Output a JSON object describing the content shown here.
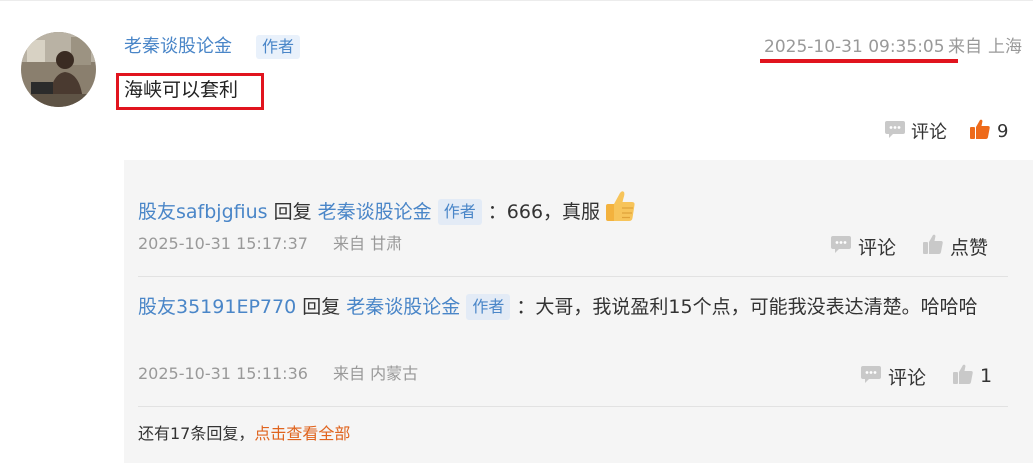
{
  "post": {
    "author": "老秦谈股论金",
    "badge": "作者",
    "time": "2025-10-31 09:35:05",
    "from_label": "来自",
    "location": "上海",
    "body": "海峡可以套利",
    "comment_label": "评论",
    "like_count": "9"
  },
  "replies": [
    {
      "user": "股友safbjgfius",
      "reply_word": "回复",
      "target": "老秦谈股论金",
      "badge": "作者",
      "text": "：666，真服",
      "time": "2025-10-31 15:17:37",
      "from_label": "来自",
      "location": "甘肃",
      "comment_label": "评论",
      "like_label": "点赞"
    },
    {
      "user": "股友35191EP770",
      "reply_word": "回复",
      "target": "老秦谈股论金",
      "badge": "作者",
      "text": "：大哥，我说盈利15个点，可能我没表达清楚。哈哈哈",
      "time": "2025-10-31 15:11:36",
      "from_label": "来自",
      "location": "内蒙古",
      "comment_label": "评论",
      "like_label": "1"
    }
  ],
  "more": {
    "prefix": "还有17条回复，",
    "link": "点击查看全部"
  },
  "colors": {
    "link_blue": "#4a86c8",
    "like_orange": "#ee6a1a",
    "highlight_red": "#e1141e",
    "more_orange": "#e0641e"
  }
}
